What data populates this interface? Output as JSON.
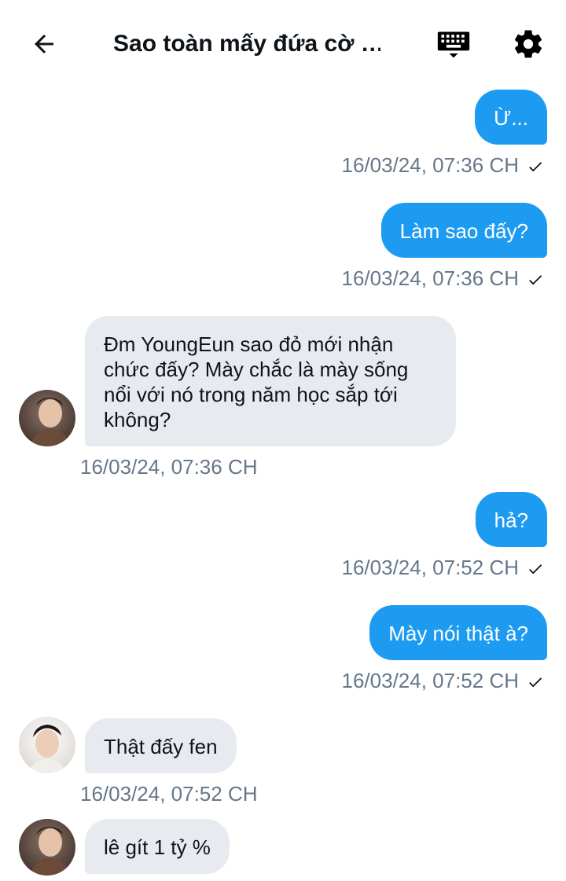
{
  "header": {
    "title": "Sao toàn mấy đứa cờ …",
    "icons": [
      "back-arrow-icon",
      "keyboard-icon",
      "gear-icon"
    ]
  },
  "colors": {
    "outgoing_bubble": "#1d9bf0",
    "incoming_bubble": "#e7ebef",
    "timestamp": "#66778a"
  },
  "messages": [
    {
      "direction": "out",
      "text": "Ừ...",
      "timestamp": "16/03/24, 07:36 CH",
      "read": true
    },
    {
      "direction": "out",
      "text": "Làm sao đấy?",
      "timestamp": "16/03/24, 07:36 CH",
      "read": true
    },
    {
      "direction": "in",
      "text": "Đm YoungEun sao đỏ mới nhận chức đấy? Mày chắc là mày sống nổi với nó trong năm học sắp tới không?",
      "timestamp": "16/03/24, 07:36 CH"
    },
    {
      "direction": "out",
      "text": "hả?",
      "timestamp": "16/03/24, 07:52 CH",
      "read": true
    },
    {
      "direction": "out",
      "text": "Mày nói thật à?",
      "timestamp": "16/03/24, 07:52 CH",
      "read": true
    },
    {
      "direction": "in",
      "text": "Thật đấy fen",
      "timestamp": "16/03/24, 07:52 CH"
    },
    {
      "direction": "in",
      "text": "lê gít 1 tỷ %",
      "timestamp": ""
    }
  ]
}
